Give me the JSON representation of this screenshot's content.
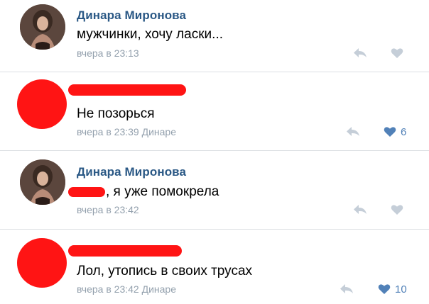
{
  "comments": [
    {
      "author": "Динара Миронова",
      "text": "мужчинки, хочу ласки...",
      "time": "вчера в 23:13",
      "liked": false,
      "like_count": ""
    },
    {
      "author": "",
      "text": "Не позорься",
      "time": "вчера в 23:39",
      "reply_to": "Динаре",
      "liked": true,
      "like_count": "6"
    },
    {
      "author": "Динара Миронова",
      "text": ", я уже помокрела",
      "time": "вчера в 23:42",
      "liked": false,
      "like_count": ""
    },
    {
      "author": "",
      "text": "Лол, утопись в своих трусах",
      "time": "вчера в 23:42",
      "reply_to": "Динаре",
      "liked": true,
      "like_count": "10"
    }
  ],
  "icons": {
    "reply": "reply-arrow-icon",
    "like": "heart-icon"
  },
  "colors": {
    "author": "#2a5885",
    "meta": "#93a0ad",
    "like_active": "#5181b8",
    "icon_inactive": "#c5ced8",
    "redaction": "#ff1414"
  }
}
